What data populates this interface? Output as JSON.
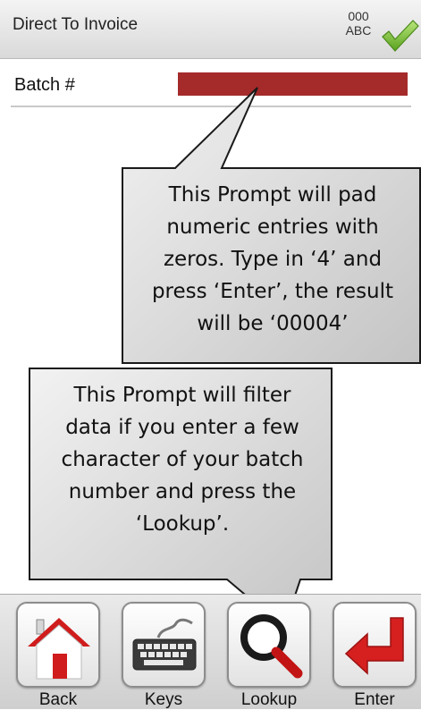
{
  "header": {
    "title": "Direct To Invoice",
    "mode_top": "000",
    "mode_bottom": "ABC"
  },
  "batch": {
    "label": "Batch #",
    "value": ""
  },
  "callouts": [
    {
      "lines": [
        "This Prompt will pad",
        "numeric entries with",
        "zeros. Type in ‘4’ and",
        "press ‘Enter’, the result",
        "will be ‘00004’"
      ]
    },
    {
      "lines": [
        "This Prompt will filter",
        "data if you enter a few",
        "character of your batch",
        "number and press the",
        "‘Lookup’."
      ]
    }
  ],
  "toolbar": {
    "back_label": "Back",
    "keys_label": "Keys",
    "lookup_label": "Lookup",
    "enter_label": "Enter"
  },
  "colors": {
    "input_fill": "#a52a2a",
    "check_green": "#7cc23a",
    "home_red": "#d01c1c",
    "enter_red": "#d61f1f"
  },
  "icons": {
    "check": "checkmark-icon",
    "back": "home-icon",
    "keys": "keyboard-icon",
    "lookup": "magnifier-icon",
    "enter": "enter-arrow-icon"
  }
}
